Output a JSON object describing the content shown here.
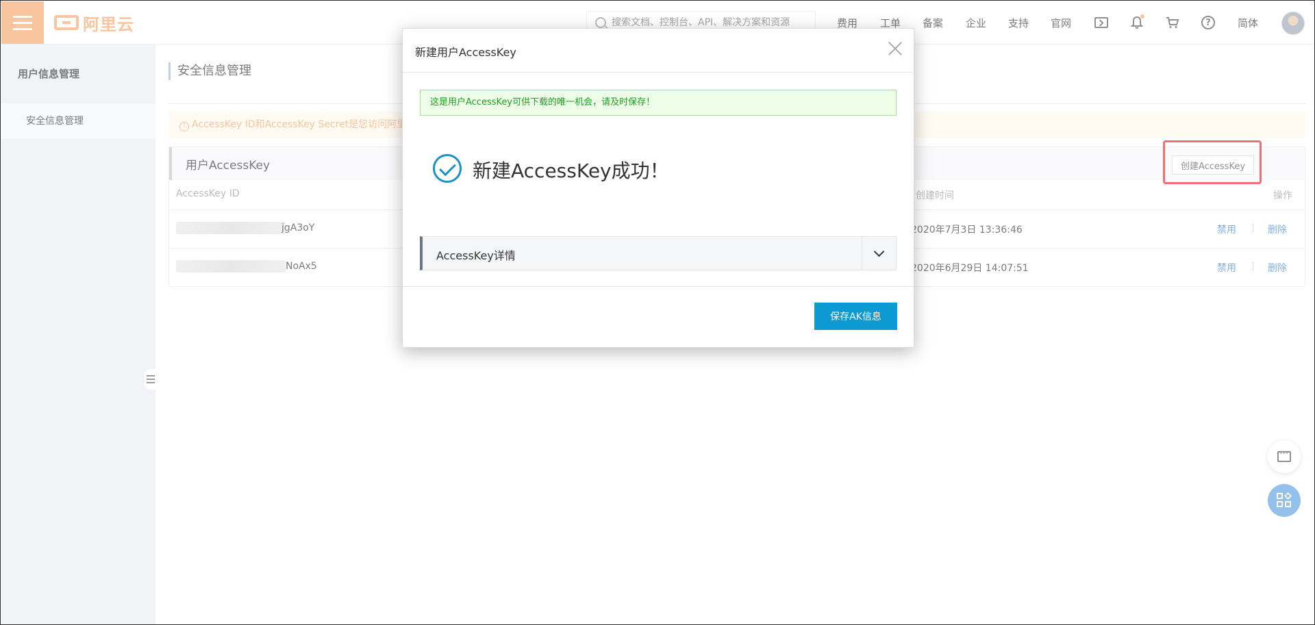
{
  "topbar": {
    "logo_text": "阿里云",
    "search_placeholder": "搜索文档、控制台、API、解决方案和资源",
    "nav": [
      "费用",
      "工单",
      "备案",
      "企业",
      "支持",
      "官网"
    ],
    "lang": "简体"
  },
  "sidebar": {
    "title": "用户信息管理",
    "items": [
      {
        "label": "安全信息管理"
      }
    ]
  },
  "main": {
    "page_title": "安全信息管理",
    "warning": "AccessKey ID和AccessKey Secret是您访问阿里云API的密钥",
    "card_title": "用户AccessKey",
    "create_button": "创建AccessKey",
    "columns": {
      "id": "AccessKey ID",
      "time": "创建时间",
      "ops": "操作"
    },
    "rows": [
      {
        "id_suffix": "jgA3oY",
        "created": "2020年7月3日 13:36:46",
        "disable": "禁用",
        "delete": "删除"
      },
      {
        "id_suffix": "NoAx5",
        "created": "2020年6月29日 14:07:51",
        "disable": "禁用",
        "delete": "删除"
      }
    ]
  },
  "modal": {
    "title": "新建用户AccessKey",
    "notice": "这是用户AccessKey可供下载的唯一机会，请及时保存！",
    "success": "新建AccessKey成功！",
    "detail_label": "AccessKey详情",
    "save_button": "保存AK信息"
  },
  "colors": {
    "brand": "#f5a76b",
    "primary": "#0d9ad2",
    "highlight": "#e8232a",
    "link": "#3f87c9"
  },
  "icons": [
    "menu-icon",
    "search-icon",
    "console-icon",
    "bell-icon",
    "cart-icon",
    "help-icon",
    "close-icon",
    "success-check-icon",
    "chevron-down-icon",
    "chat-icon",
    "apps-icon"
  ]
}
